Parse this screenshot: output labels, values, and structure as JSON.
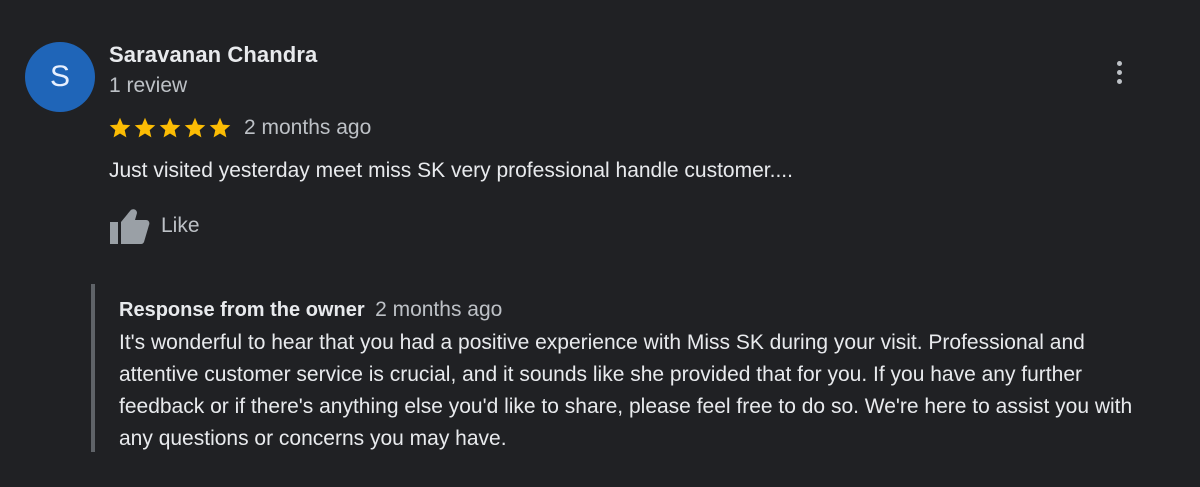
{
  "review": {
    "avatar_letter": "S",
    "avatar_color": "#1f65b8",
    "reviewer_name": "Saravanan Chandra",
    "review_count": "1 review",
    "rating": 5,
    "rating_max": 5,
    "star_color": "#fbbc04",
    "date": "2 months ago",
    "text": "Just visited yesterday meet miss SK very professional handle customer....",
    "like_label": "Like",
    "like_icon": "thumb-up-icon",
    "more_icon": "more-vert-icon"
  },
  "owner_response": {
    "title": "Response from the owner",
    "date": "2 months ago",
    "text": "It's wonderful to hear that you had a positive experience with Miss SK during your visit. Professional and attentive customer service is crucial, and it sounds like she provided that for you. If you have any further feedback or if there's anything else you'd like to share, please feel free to do so. We're here to assist you with any questions or concerns you may have."
  }
}
